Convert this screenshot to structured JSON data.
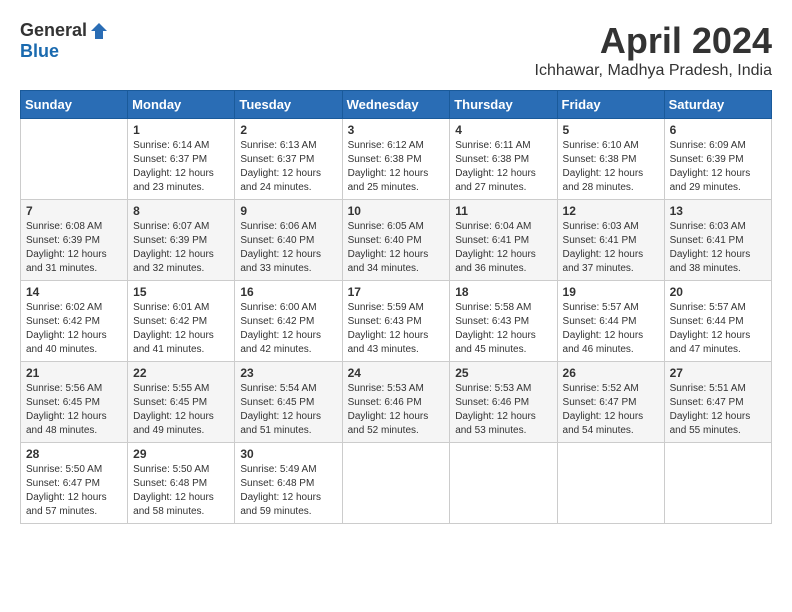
{
  "logo": {
    "general": "General",
    "blue": "Blue"
  },
  "title": {
    "month": "April 2024",
    "location": "Ichhawar, Madhya Pradesh, India"
  },
  "weekdays": [
    "Sunday",
    "Monday",
    "Tuesday",
    "Wednesday",
    "Thursday",
    "Friday",
    "Saturday"
  ],
  "weeks": [
    [
      {
        "day": null,
        "info": null
      },
      {
        "day": "1",
        "info": "Sunrise: 6:14 AM\nSunset: 6:37 PM\nDaylight: 12 hours\nand 23 minutes."
      },
      {
        "day": "2",
        "info": "Sunrise: 6:13 AM\nSunset: 6:37 PM\nDaylight: 12 hours\nand 24 minutes."
      },
      {
        "day": "3",
        "info": "Sunrise: 6:12 AM\nSunset: 6:38 PM\nDaylight: 12 hours\nand 25 minutes."
      },
      {
        "day": "4",
        "info": "Sunrise: 6:11 AM\nSunset: 6:38 PM\nDaylight: 12 hours\nand 27 minutes."
      },
      {
        "day": "5",
        "info": "Sunrise: 6:10 AM\nSunset: 6:38 PM\nDaylight: 12 hours\nand 28 minutes."
      },
      {
        "day": "6",
        "info": "Sunrise: 6:09 AM\nSunset: 6:39 PM\nDaylight: 12 hours\nand 29 minutes."
      }
    ],
    [
      {
        "day": "7",
        "info": "Sunrise: 6:08 AM\nSunset: 6:39 PM\nDaylight: 12 hours\nand 31 minutes."
      },
      {
        "day": "8",
        "info": "Sunrise: 6:07 AM\nSunset: 6:39 PM\nDaylight: 12 hours\nand 32 minutes."
      },
      {
        "day": "9",
        "info": "Sunrise: 6:06 AM\nSunset: 6:40 PM\nDaylight: 12 hours\nand 33 minutes."
      },
      {
        "day": "10",
        "info": "Sunrise: 6:05 AM\nSunset: 6:40 PM\nDaylight: 12 hours\nand 34 minutes."
      },
      {
        "day": "11",
        "info": "Sunrise: 6:04 AM\nSunset: 6:41 PM\nDaylight: 12 hours\nand 36 minutes."
      },
      {
        "day": "12",
        "info": "Sunrise: 6:03 AM\nSunset: 6:41 PM\nDaylight: 12 hours\nand 37 minutes."
      },
      {
        "day": "13",
        "info": "Sunrise: 6:03 AM\nSunset: 6:41 PM\nDaylight: 12 hours\nand 38 minutes."
      }
    ],
    [
      {
        "day": "14",
        "info": "Sunrise: 6:02 AM\nSunset: 6:42 PM\nDaylight: 12 hours\nand 40 minutes."
      },
      {
        "day": "15",
        "info": "Sunrise: 6:01 AM\nSunset: 6:42 PM\nDaylight: 12 hours\nand 41 minutes."
      },
      {
        "day": "16",
        "info": "Sunrise: 6:00 AM\nSunset: 6:42 PM\nDaylight: 12 hours\nand 42 minutes."
      },
      {
        "day": "17",
        "info": "Sunrise: 5:59 AM\nSunset: 6:43 PM\nDaylight: 12 hours\nand 43 minutes."
      },
      {
        "day": "18",
        "info": "Sunrise: 5:58 AM\nSunset: 6:43 PM\nDaylight: 12 hours\nand 45 minutes."
      },
      {
        "day": "19",
        "info": "Sunrise: 5:57 AM\nSunset: 6:44 PM\nDaylight: 12 hours\nand 46 minutes."
      },
      {
        "day": "20",
        "info": "Sunrise: 5:57 AM\nSunset: 6:44 PM\nDaylight: 12 hours\nand 47 minutes."
      }
    ],
    [
      {
        "day": "21",
        "info": "Sunrise: 5:56 AM\nSunset: 6:45 PM\nDaylight: 12 hours\nand 48 minutes."
      },
      {
        "day": "22",
        "info": "Sunrise: 5:55 AM\nSunset: 6:45 PM\nDaylight: 12 hours\nand 49 minutes."
      },
      {
        "day": "23",
        "info": "Sunrise: 5:54 AM\nSunset: 6:45 PM\nDaylight: 12 hours\nand 51 minutes."
      },
      {
        "day": "24",
        "info": "Sunrise: 5:53 AM\nSunset: 6:46 PM\nDaylight: 12 hours\nand 52 minutes."
      },
      {
        "day": "25",
        "info": "Sunrise: 5:53 AM\nSunset: 6:46 PM\nDaylight: 12 hours\nand 53 minutes."
      },
      {
        "day": "26",
        "info": "Sunrise: 5:52 AM\nSunset: 6:47 PM\nDaylight: 12 hours\nand 54 minutes."
      },
      {
        "day": "27",
        "info": "Sunrise: 5:51 AM\nSunset: 6:47 PM\nDaylight: 12 hours\nand 55 minutes."
      }
    ],
    [
      {
        "day": "28",
        "info": "Sunrise: 5:50 AM\nSunset: 6:47 PM\nDaylight: 12 hours\nand 57 minutes."
      },
      {
        "day": "29",
        "info": "Sunrise: 5:50 AM\nSunset: 6:48 PM\nDaylight: 12 hours\nand 58 minutes."
      },
      {
        "day": "30",
        "info": "Sunrise: 5:49 AM\nSunset: 6:48 PM\nDaylight: 12 hours\nand 59 minutes."
      },
      {
        "day": null,
        "info": null
      },
      {
        "day": null,
        "info": null
      },
      {
        "day": null,
        "info": null
      },
      {
        "day": null,
        "info": null
      }
    ]
  ]
}
